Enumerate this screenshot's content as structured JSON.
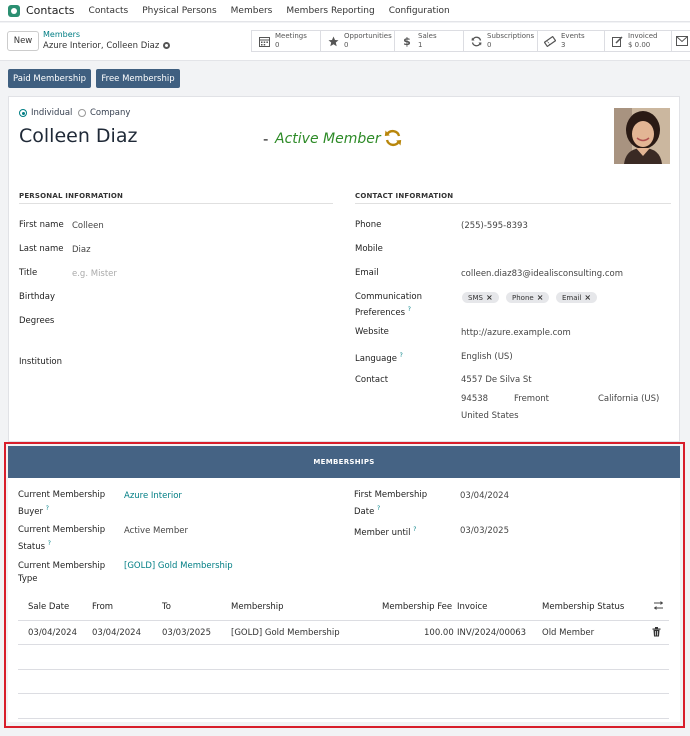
{
  "topnav": {
    "app_name": "Contacts",
    "items": [
      "Contacts",
      "Physical Persons",
      "Members",
      "Members Reporting",
      "Configuration"
    ]
  },
  "control": {
    "new_label": "New",
    "breadcrumb_parent": "Members",
    "breadcrumb_current": "Azure Interior, Colleen Diaz",
    "stats": [
      {
        "title": "Meetings",
        "value": "0",
        "icon": "calendar-icon"
      },
      {
        "title": "Opportunities",
        "value": "0",
        "icon": "star-icon"
      },
      {
        "title": "Sales",
        "value": "1",
        "icon": "dollar-icon"
      },
      {
        "title": "Subscriptions",
        "value": "0",
        "icon": "refresh-icon"
      },
      {
        "title": "Events",
        "value": "3",
        "icon": "ticket-icon"
      },
      {
        "title": "Invoiced",
        "value": "$ 0.00",
        "icon": "invoice-icon"
      }
    ]
  },
  "actions": {
    "paid": "Paid Membership",
    "free": "Free Membership"
  },
  "form": {
    "type_individual": "Individual",
    "type_company": "Company",
    "name": "Colleen Diaz",
    "status_dash": "-",
    "status": "Active Member",
    "personal_header": "PERSONAL INFORMATION",
    "contact_header": "CONTACT INFORMATION",
    "first_name_label": "First name",
    "first_name": "Colleen",
    "last_name_label": "Last name",
    "last_name": "Diaz",
    "title_label": "Title",
    "title_placeholder": "e.g. Mister",
    "birthday_label": "Birthday",
    "degrees_label": "Degrees",
    "institution_label": "Institution",
    "phone_label": "Phone",
    "phone": "(255)-595-8393",
    "mobile_label": "Mobile",
    "email_label": "Email",
    "email": "colleen.diaz83@idealisconsulting.com",
    "comm_label_1": "Communication",
    "comm_label_2": "Preferences",
    "comm_tags": [
      "SMS",
      "Phone",
      "Email"
    ],
    "website_label": "Website",
    "website": "http://azure.example.com",
    "language_label": "Language",
    "language": "English (US)",
    "contact_label": "Contact",
    "street": "4557 De Silva St",
    "zip": "94538",
    "city": "Fremont",
    "state": "California (US)",
    "country": "United States",
    "tooltip_mark": "?"
  },
  "memberships": {
    "banner": "MEMBERSHIPS",
    "buyer_label_1": "Current Membership",
    "buyer_label_2": "Buyer",
    "buyer": "Azure Interior",
    "status_label_1": "Current Membership",
    "status_label_2": "Status",
    "status": "Active Member",
    "type_label_1": "Current Membership",
    "type_label_2": "Type",
    "type": "[GOLD] Gold Membership",
    "first_date_label_1": "First Membership",
    "first_date_label_2": "Date",
    "first_date": "03/04/2024",
    "until_label": "Member until",
    "until": "03/03/2025",
    "columns": [
      "Sale Date",
      "From",
      "To",
      "Membership",
      "Membership Fee",
      "Invoice",
      "Membership Status"
    ],
    "rows": [
      [
        "03/04/2024",
        "03/04/2024",
        "03/03/2025",
        "[GOLD] Gold Membership",
        "100.00",
        "INV/2024/00063",
        "Old Member"
      ]
    ]
  }
}
